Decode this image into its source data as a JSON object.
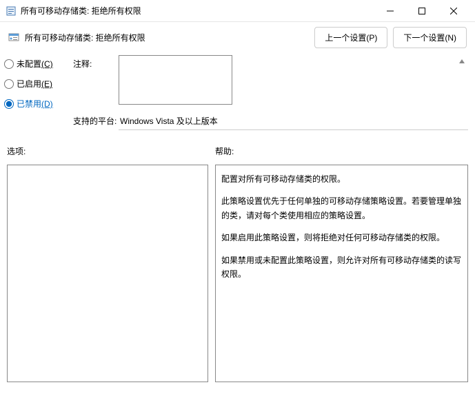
{
  "window": {
    "title": "所有可移动存储类: 拒绝所有权限"
  },
  "header": {
    "title": "所有可移动存储类: 拒绝所有权限",
    "prev_btn": "上一个设置(P)",
    "next_btn": "下一个设置(N)"
  },
  "radios": {
    "not_configured": "未配置",
    "not_configured_key": "(C)",
    "enabled": "已启用",
    "enabled_key": "(E)",
    "disabled": "已禁用",
    "disabled_key": "(D)"
  },
  "fields": {
    "comment_label": "注释:",
    "comment_value": "",
    "platform_label": "支持的平台:",
    "platform_value": "Windows Vista 及以上版本"
  },
  "lower": {
    "options_label": "选项:",
    "help_label": "帮助:"
  },
  "help": {
    "p1": "配置对所有可移动存储类的权限。",
    "p2": "此策略设置优先于任何单独的可移动存储策略设置。若要管理单独的类，请对每个类使用相应的策略设置。",
    "p3": "如果启用此策略设置，则将拒绝对任何可移动存储类的权限。",
    "p4": "如果禁用或未配置此策略设置，则允许对所有可移动存储类的读写权限。"
  }
}
